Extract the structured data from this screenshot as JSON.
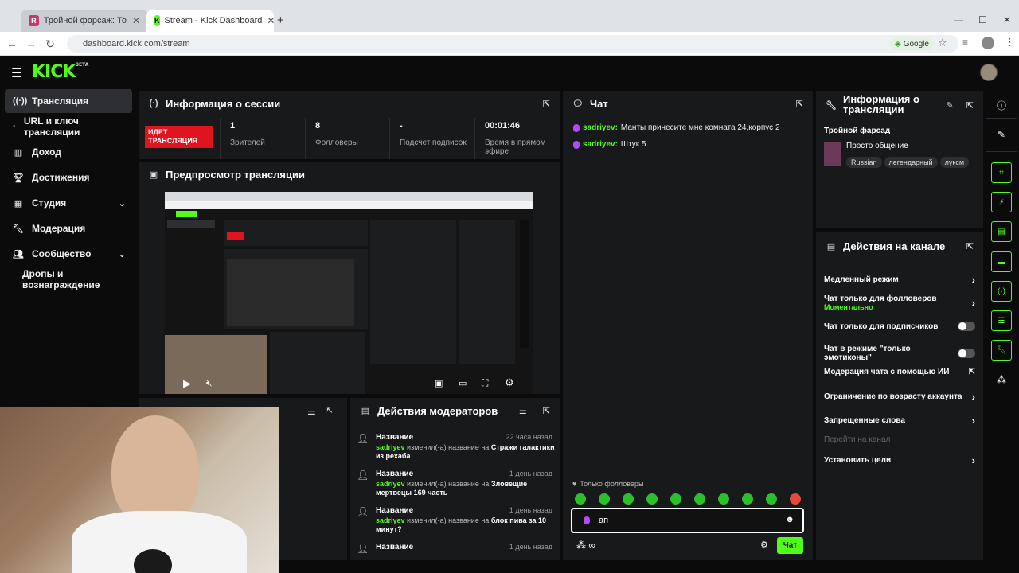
{
  "browser": {
    "tabs": [
      {
        "title": "Тройной форсаж: Токийский д",
        "active": false
      },
      {
        "title": "Stream - Kick Dashboard",
        "active": true
      }
    ],
    "new_tab": "+",
    "url": "dashboard.kick.com/stream",
    "google_chip": "Google"
  },
  "logo": {
    "text": "KICK",
    "badge": "BETA"
  },
  "sidebar": {
    "items": [
      {
        "label": "Трансляция",
        "icon": "broadcast-icon"
      },
      {
        "label": "URL и ключ трансляции",
        "icon": "bullet"
      },
      {
        "label": "Доход",
        "icon": "chart-icon"
      },
      {
        "label": "Достижения",
        "icon": "trophy-icon"
      },
      {
        "label": "Студия",
        "icon": "grid-icon"
      },
      {
        "label": "Модерация",
        "icon": "wrench-icon"
      },
      {
        "label": "Сообщество",
        "icon": "people-icon"
      },
      {
        "label": "Дропы и вознаграждение",
        "icon": ""
      }
    ]
  },
  "session": {
    "title": "Информация о сессии",
    "live_label": "ИДЕТ ТРАНСЛЯЦИЯ",
    "stats": [
      {
        "value": "1",
        "label": "Зрителей"
      },
      {
        "value": "8",
        "label": "Фолловеры"
      },
      {
        "value": "-",
        "label": "Подсчет подписок"
      },
      {
        "value": "00:01:46",
        "label": "Время в прямом эфире"
      }
    ]
  },
  "preview": {
    "title": "Предпросмотр трансляции"
  },
  "modlog": {
    "title": "Действия модераторов",
    "rows": [
      {
        "title": "Название",
        "time": "22 часа назад",
        "user": "sadriyev",
        "changed": "изменил(-а) название на",
        "new": "Стражи галактики из рехаба"
      },
      {
        "title": "Название",
        "time": "1 день назад",
        "user": "sadriyev",
        "changed": "изменил(-а) название на",
        "new": "Зловещие мертвецы 169 часть"
      },
      {
        "title": "Название",
        "time": "1 день назад",
        "user": "sadriyev",
        "changed": "изменил(-а) название на",
        "new": "блок пива за 10 минут?"
      },
      {
        "title": "Название",
        "time": "1 день назад",
        "user": "",
        "changed": "",
        "new": ""
      }
    ]
  },
  "chat": {
    "title": "Чат",
    "messages": [
      {
        "user": "sadriyev:",
        "text": "Манты принесите мне комната 24,корпус 2"
      },
      {
        "user": "sadriyev:",
        "text": "Штук 5"
      }
    ],
    "followers_only": "Только фолловеры",
    "input_value": "ап",
    "send_label": "Чат"
  },
  "stream_info": {
    "title": "Информация о трансляции",
    "stream_title": "Тройной фарсад",
    "category": "Просто общение",
    "tags": [
      "Russian",
      "легендарный",
      "луксм"
    ]
  },
  "channel_actions": {
    "title": "Действия на канале",
    "items": [
      {
        "label": "Медленный режим",
        "sub": "",
        "control": "arrow"
      },
      {
        "label": "Чат только для фолловеров",
        "sub": "Моментально",
        "control": "arrow"
      },
      {
        "label": "Чат только для подписчиков",
        "sub": "",
        "control": "toggle"
      },
      {
        "label": "Чат в режиме \"только эмотиконы\"",
        "sub": "",
        "control": "toggle"
      },
      {
        "label": "Модерация чата с помощью ИИ",
        "sub": "",
        "control": "external"
      },
      {
        "label": "Ограничение по возрасту аккаунта",
        "sub": "",
        "control": "arrow"
      },
      {
        "label": "Запрещенные слова",
        "sub": "",
        "control": "arrow"
      },
      {
        "label": "Перейти на канал",
        "sub": "",
        "control": "none"
      },
      {
        "label": "Установить цели",
        "sub": "",
        "control": "arrow"
      }
    ]
  },
  "colors": {
    "accent": "#53fc18",
    "live": "#e0141e",
    "panel": "#18191b"
  }
}
